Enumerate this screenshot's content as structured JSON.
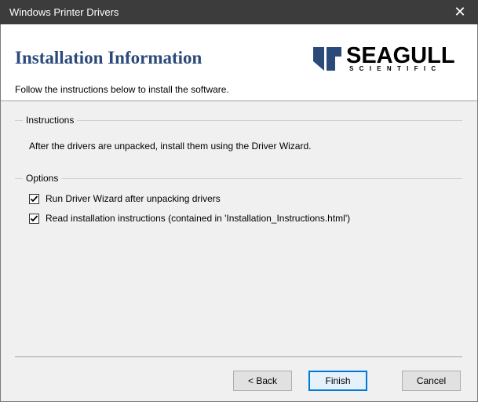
{
  "window": {
    "title": "Windows Printer Drivers",
    "close_glyph": "✕"
  },
  "header": {
    "heading": "Installation Information",
    "subtitle": "Follow the instructions below to install the software.",
    "logo_word": "SEAGULL",
    "logo_sub": "SCIENTIFIC",
    "logo_accent_color": "#2b4a7a"
  },
  "instructions": {
    "legend": "Instructions",
    "text": "After the drivers are unpacked, install them using the Driver Wizard."
  },
  "options": {
    "legend": "Options",
    "items": [
      {
        "label": "Run Driver Wizard after unpacking drivers",
        "checked": true
      },
      {
        "label": "Read installation instructions (contained in 'Installation_Instructions.html')",
        "checked": true
      }
    ]
  },
  "buttons": {
    "back": "< Back",
    "finish": "Finish",
    "cancel": "Cancel"
  },
  "colors": {
    "titlebar": "#3c3c3c",
    "heading": "#2b4a7a",
    "focus_border": "#0078d7"
  }
}
